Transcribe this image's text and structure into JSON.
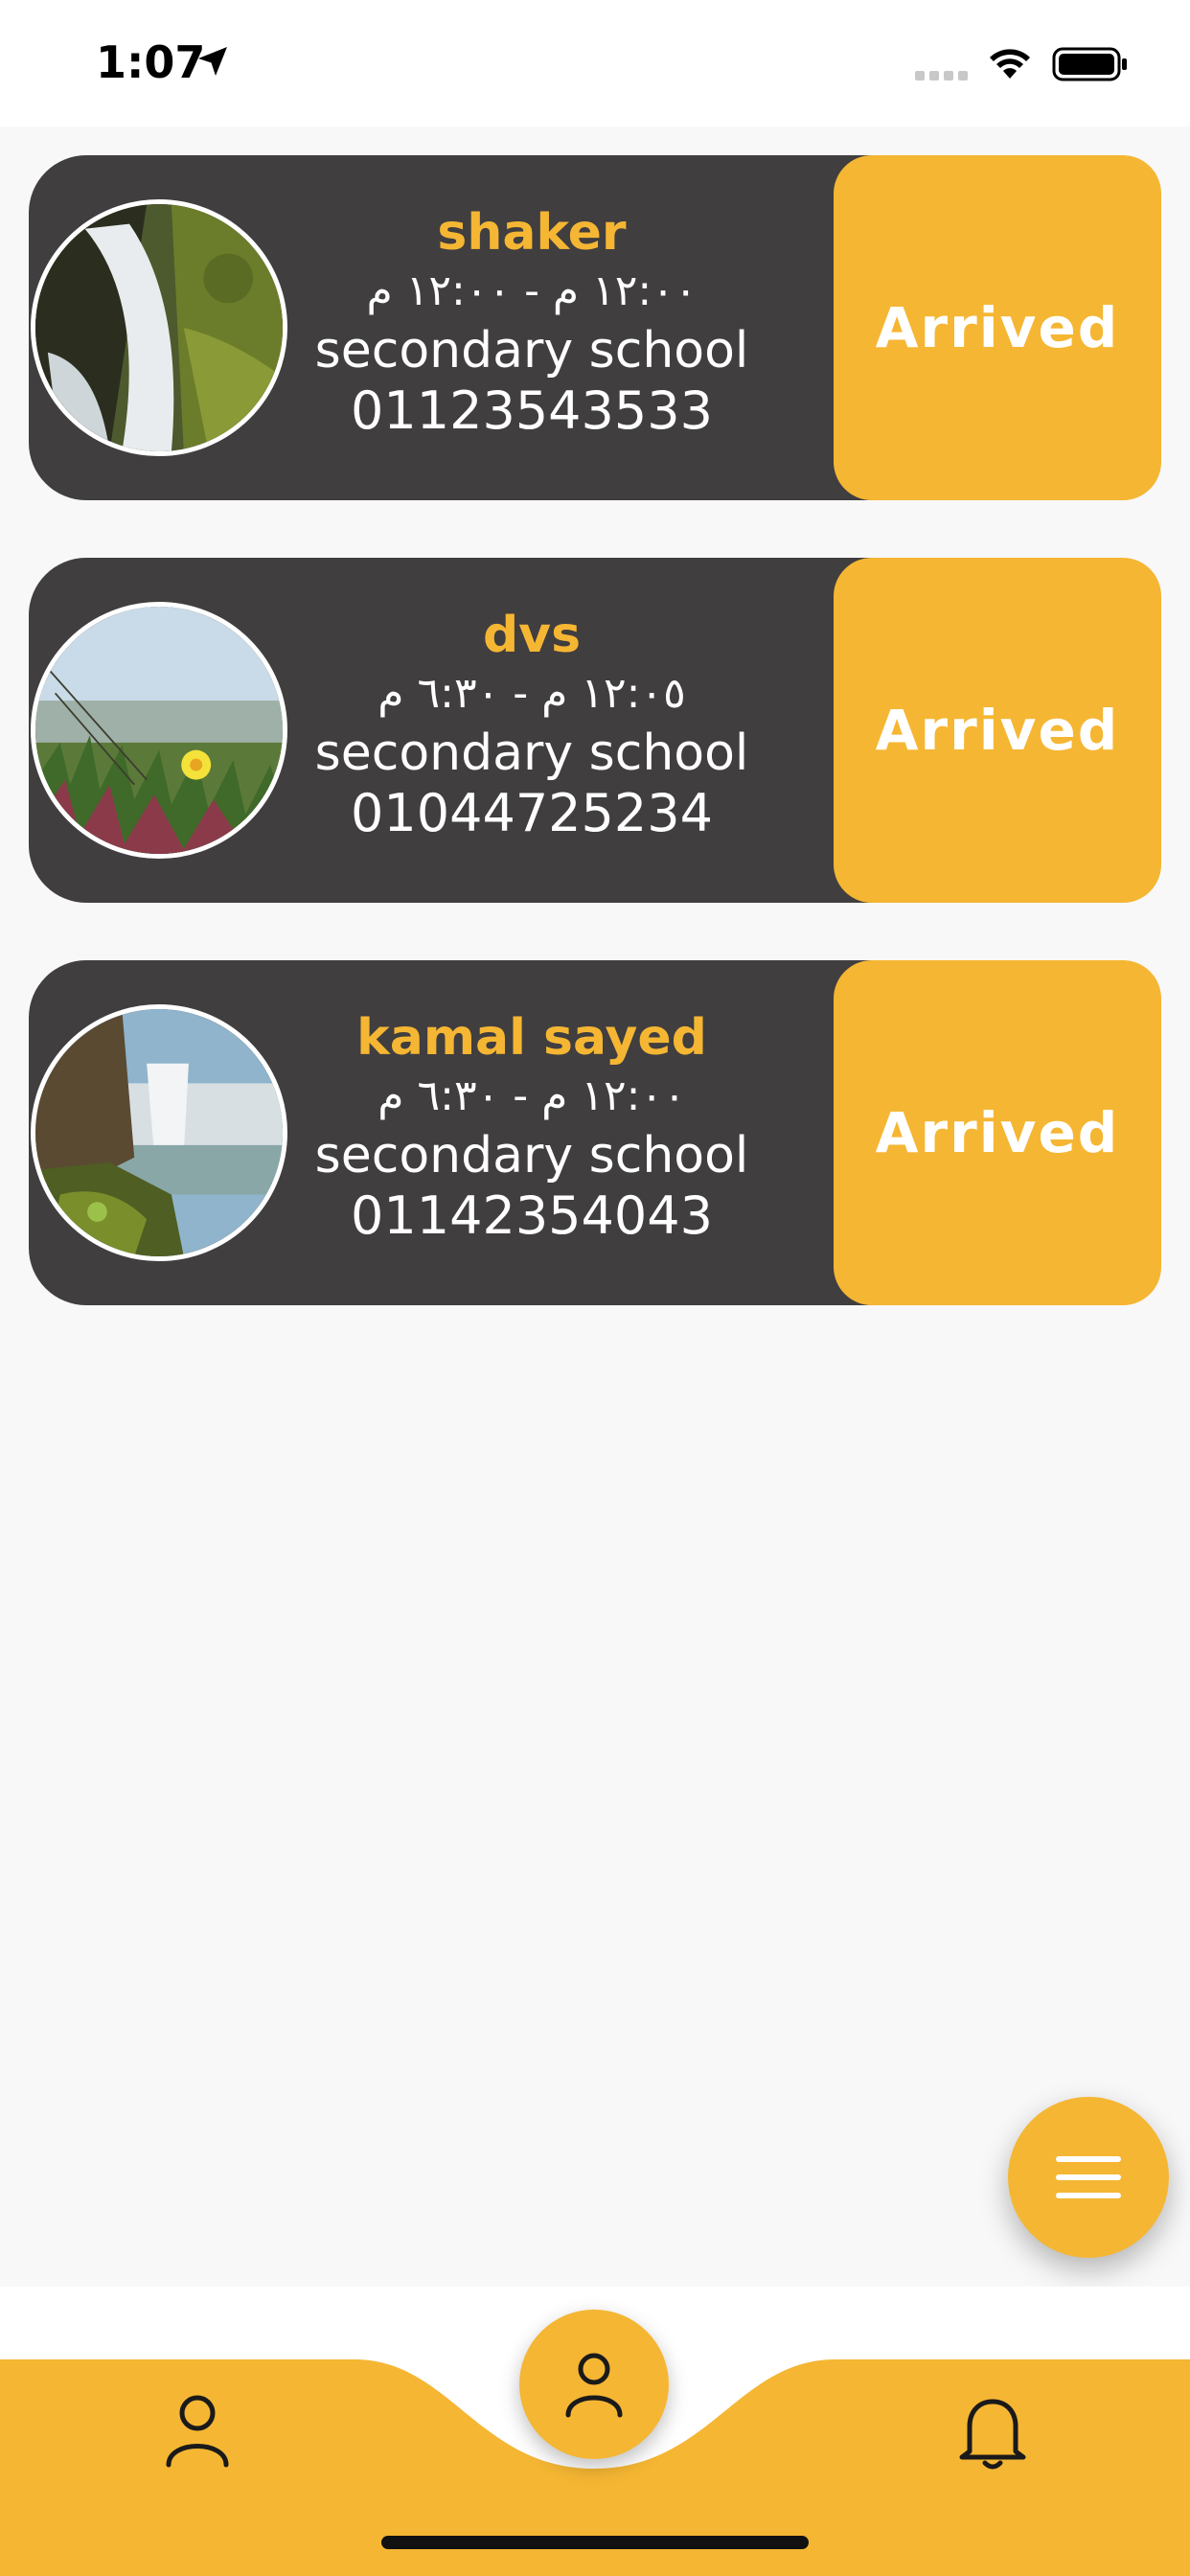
{
  "status_bar": {
    "time": "1:07",
    "icons": [
      "location-arrow-icon",
      "signal-icon",
      "wifi-icon",
      "battery-icon"
    ]
  },
  "cards": [
    {
      "name": "shaker",
      "time": "١٢:٠٠ م - ١٢:٠٠ م",
      "school": "secondary school",
      "phone": "01123543533",
      "button": "Arrived",
      "image": "waterfall-mossy-rocks"
    },
    {
      "name": "dvs",
      "time": "١٢:٠٥ م - ٦:٣٠ م",
      "school": "secondary school",
      "phone": "01044725234",
      "button": "Arrived",
      "image": "yellow-flower-grass"
    },
    {
      "name": "kamal sayed",
      "time": "١٢:٠٠ م - ٦:٣٠ م",
      "school": "secondary school",
      "phone": "01142354043",
      "button": "Arrived",
      "image": "waterfall-coast"
    }
  ],
  "fab": {
    "icon": "menu-icon"
  },
  "bottom_nav": {
    "left_icon": "person-icon",
    "center_icon": "person-icon",
    "right_icon": "bell-icon"
  },
  "colors": {
    "accent": "#f5b633",
    "card_bg": "#403e3f",
    "page_bg": "#f8f8f8"
  }
}
